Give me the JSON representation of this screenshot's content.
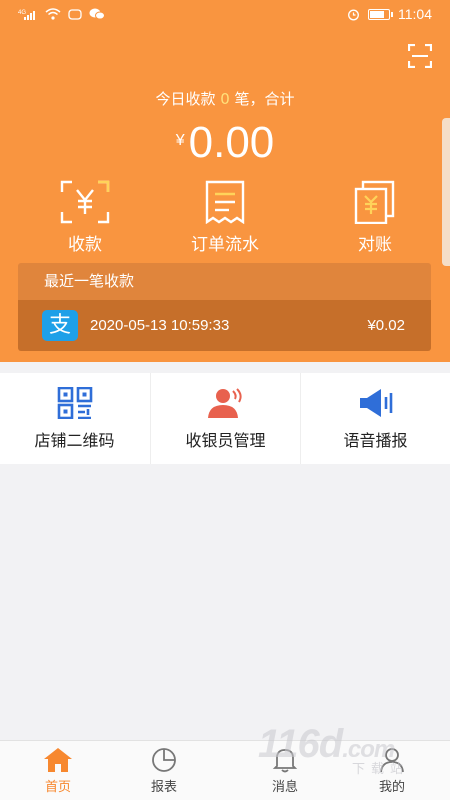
{
  "status_bar": {
    "network": "4G",
    "time": "11:04",
    "battery_level": 0.85
  },
  "header": {
    "summary_prefix": "今日收款 ",
    "summary_count": "0",
    "summary_suffix": " 笔，合计",
    "currency_symbol": "¥",
    "total_amount": "0.00"
  },
  "actions": [
    {
      "label": "收款",
      "icon": "yuan-scan-icon"
    },
    {
      "label": "订单流水",
      "icon": "receipt-icon"
    },
    {
      "label": "对账",
      "icon": "reconcile-icon"
    }
  ],
  "recent": {
    "title": "最近一笔收款",
    "pay_icon_glyph": "支",
    "time": "2020-05-13 10:59:33",
    "amount": "¥0.02"
  },
  "tiles": [
    {
      "label": "店铺二维码",
      "icon": "qr-code-icon",
      "color": "#2f6ed8"
    },
    {
      "label": "收银员管理",
      "icon": "cashier-icon",
      "color": "#e8614e"
    },
    {
      "label": "语音播报",
      "icon": "speaker-icon",
      "color": "#2f6ed8"
    }
  ],
  "nav": [
    {
      "label": "首页",
      "icon": "home-icon",
      "active": true
    },
    {
      "label": "报表",
      "icon": "pie-chart-icon",
      "active": false
    },
    {
      "label": "消息",
      "icon": "bell-icon",
      "active": false
    },
    {
      "label": "我的",
      "icon": "user-icon",
      "active": false
    }
  ],
  "watermark": {
    "brand": "116d",
    "suffix": ".com",
    "sub": "下载站"
  },
  "colors": {
    "primary": "#f99540",
    "accent": "#f7882f",
    "tile_blue": "#2f6ed8",
    "tile_red": "#e8614e"
  }
}
